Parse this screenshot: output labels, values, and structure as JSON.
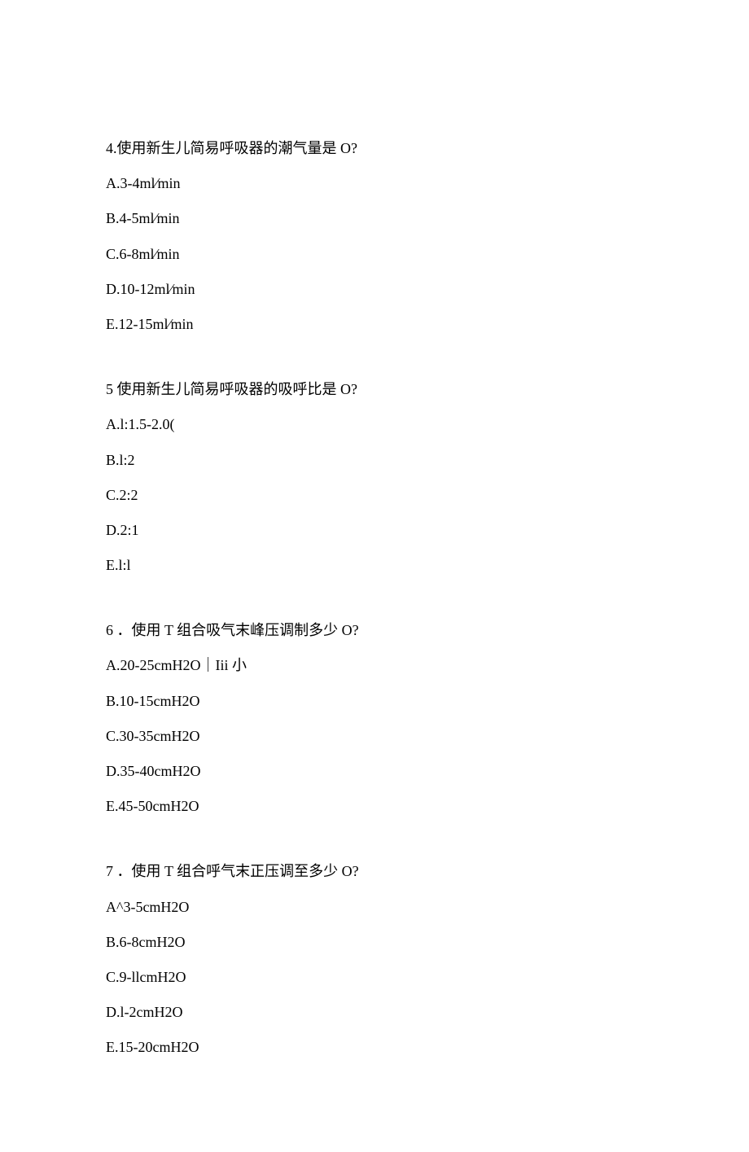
{
  "questions": [
    {
      "stem": "4.使用新生儿简易呼吸器的潮气量是 O?",
      "options": [
        "A.3-4ml⁄min",
        "B.4-5ml⁄min",
        "C.6-8ml⁄min",
        "D.10-12ml⁄min",
        "E.12-15ml⁄min"
      ]
    },
    {
      "stem": "5 使用新生儿简易呼吸器的吸呼比是 O?",
      "options": [
        "A.l:1.5-2.0(",
        "B.l:2",
        "C.2:2",
        "D.2:1",
        "E.l:l"
      ]
    },
    {
      "stem": "6 ．使用 T 组合吸气末峰压调制多少 O?",
      "options": [
        "A.20-25cmH2O｜Iii 小",
        "B.10-15cmH2O",
        "C.30-35cmH2O",
        "D.35-40cmH2O",
        "E.45-50cmH2O"
      ]
    },
    {
      "stem": "7 ．使用 T 组合呼气末正压调至多少 O?",
      "options": [
        "A^3-5cmH2O",
        "B.6-8cmH2O",
        "C.9-llcmH2O",
        "D.l-2cmH2O",
        "E.15-20cmH2O"
      ]
    }
  ]
}
